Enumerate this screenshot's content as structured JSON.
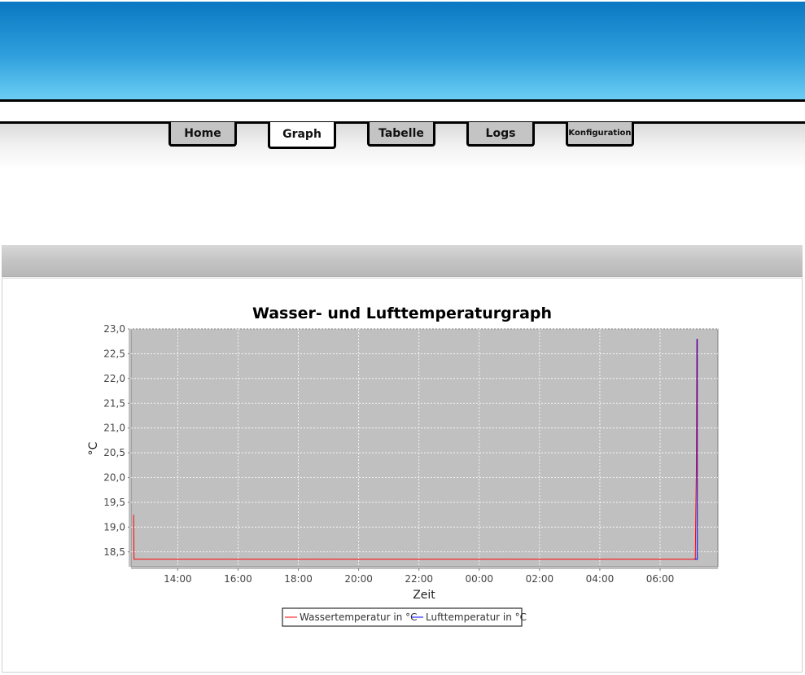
{
  "nav": {
    "tabs": [
      {
        "label": "Home",
        "active": false
      },
      {
        "label": "Graph",
        "active": true
      },
      {
        "label": "Tabelle",
        "active": false
      },
      {
        "label": "Logs",
        "active": false
      },
      {
        "label": "Konfiguration",
        "active": false
      }
    ]
  },
  "colors": {
    "banner_top": "#0a78c2",
    "banner_bottom": "#6acdf4",
    "plot_background": "#c0c0c0",
    "series_water": "#ff0000",
    "series_air": "#0000ff"
  },
  "chart_data": {
    "type": "line",
    "title": "Wasser- und Lufttemperaturgraph",
    "xlabel": "Zeit",
    "ylabel": "°C",
    "x_tick_labels": [
      "14:00",
      "16:00",
      "18:00",
      "20:00",
      "22:00",
      "00:00",
      "02:00",
      "04:00",
      "06:00"
    ],
    "y_tick_labels": [
      "18,5",
      "19,0",
      "19,5",
      "20,0",
      "20,5",
      "21,0",
      "21,5",
      "22,0",
      "22,5",
      "23,0"
    ],
    "xlim": [
      "12:27",
      "07:55"
    ],
    "ylim": [
      18.2,
      23.0
    ],
    "grid": true,
    "legend_position": "bottom",
    "series": [
      {
        "name": "Wassertemperatur in °C",
        "color": "#ff0000",
        "points": [
          [
            "12:32",
            19.25
          ],
          [
            "12:33",
            18.35
          ],
          [
            "12:35",
            18.35
          ],
          [
            "07:10",
            18.35
          ],
          [
            "07:11",
            19.25
          ],
          [
            "07:12",
            20.15
          ],
          [
            "07:13",
            22.8
          ]
        ]
      },
      {
        "name": "Lufttemperatur in °C",
        "color": "#0000ff",
        "points": [
          [
            "07:09",
            18.35
          ],
          [
            "07:14",
            18.35
          ],
          [
            "07:14",
            22.8
          ]
        ]
      }
    ]
  }
}
